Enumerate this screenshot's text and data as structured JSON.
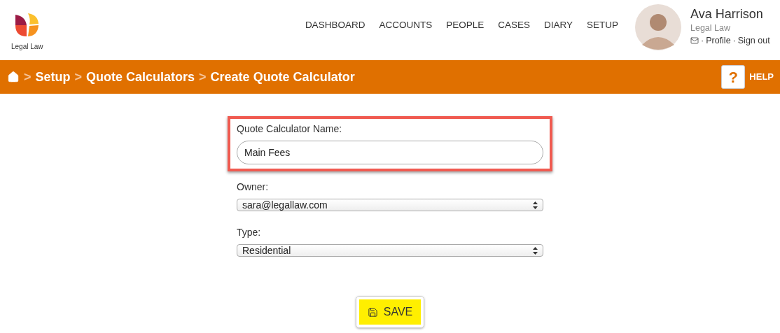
{
  "brand": {
    "name": "Legal Law"
  },
  "nav": [
    {
      "label": "DASHBOARD"
    },
    {
      "label": "ACCOUNTS"
    },
    {
      "label": "PEOPLE"
    },
    {
      "label": "CASES"
    },
    {
      "label": "DIARY"
    },
    {
      "label": "SETUP"
    }
  ],
  "user": {
    "name": "Ava Harrison",
    "company": "Legal Law",
    "separator_1": "·",
    "profile": "Profile",
    "separator_2": "·",
    "sign_out": "Sign out"
  },
  "breadcrumb": {
    "separator": ">",
    "items": [
      "Setup",
      "Quote Calculators",
      "Create Quote Calculator"
    ]
  },
  "help": {
    "icon": "?",
    "label": "HELP"
  },
  "form": {
    "fields": [
      {
        "kind": "text",
        "label": "Quote Calculator Name:",
        "value": "Main Fees",
        "highlighted": true
      },
      {
        "kind": "select",
        "label": "Owner:",
        "value": "sara@legallaw.com",
        "highlighted": false
      },
      {
        "kind": "select",
        "label": "Type:",
        "value": "Residential",
        "highlighted": false
      }
    ]
  },
  "save_button": {
    "label": "SAVE"
  }
}
